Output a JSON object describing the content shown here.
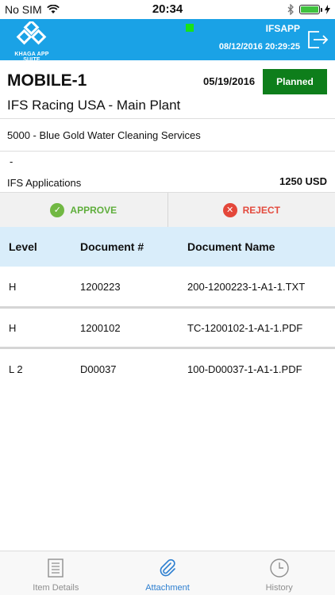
{
  "status_bar": {
    "carrier": "No SIM",
    "time": "20:34"
  },
  "header": {
    "logo_text": "KHAGA APP SUITE",
    "user": "IFSAPP",
    "datetime": "08/12/2016 20:29:25"
  },
  "order": {
    "title": "MOBILE-1",
    "date": "05/19/2016",
    "status": "Planned",
    "site": "IFS Racing USA - Main Plant",
    "supplier": "5000 - Blue Gold Water Cleaning Services",
    "dash": "-",
    "company": "IFS Applications",
    "amount": "1250 USD"
  },
  "actions": {
    "approve": "APPROVE",
    "reject": "REJECT"
  },
  "table": {
    "headers": [
      "Level",
      "Document #",
      "Document Name"
    ],
    "rows": [
      [
        "H",
        "1200223",
        "200-1200223-1-A1-1.TXT"
      ],
      [
        "H",
        "1200102",
        "TC-1200102-1-A1-1.PDF"
      ],
      [
        "L 2",
        "D00037",
        "100-D00037-1-A1-1.PDF"
      ]
    ]
  },
  "tabs": [
    {
      "label": "Item Details",
      "icon": "list-icon"
    },
    {
      "label": "Attachment",
      "icon": "paperclip-icon"
    },
    {
      "label": "History",
      "icon": "clock-icon"
    }
  ],
  "colors": {
    "header": "#1aa2e6",
    "planned": "#0e7e1b",
    "approve": "#5fae3c",
    "reject": "#e34a3d",
    "table_header": "#d9edfa",
    "active_tab": "#2d7fd0"
  }
}
